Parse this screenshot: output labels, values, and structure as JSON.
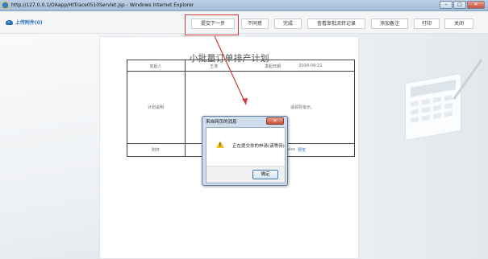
{
  "window": {
    "title": "http://127.0.0.1/OAapp/HtTrace0510Servlet.jsp - Windows Internet Explorer",
    "min_glyph": "–",
    "max_glyph": "□",
    "close_glyph": "✕"
  },
  "toolbar": {
    "upload_label": "上传附件(0)",
    "buttons": {
      "submit_next": "提交下一步",
      "disagree": "不同意",
      "finish": "完成",
      "view_history": "查看审批流转记录",
      "add_note": "添加备注",
      "print": "打印",
      "close": "关闭"
    }
  },
  "document": {
    "title": "小批量订单排产计划",
    "initiator_label": "发起人",
    "initiator_value": "王涛",
    "date_label": "发起日期",
    "date_value": "2016-09-21",
    "plan_label": "计划说明",
    "plan_text_fragment": "请领导批示。",
    "attachment_label": "附件",
    "attachment_text_fragment": "xlsx",
    "attachment_link": "预览"
  },
  "dialog": {
    "title": "来自网页的消息",
    "close_glyph": "✕",
    "icon": "warning-icon",
    "message": "正在提交你的申请(请等待)",
    "ok_label": "确定"
  },
  "colors": {
    "accent_blue": "#2b6fb8",
    "annotation_red": "#d43a3a",
    "warning_yellow": "#f2c21b"
  }
}
